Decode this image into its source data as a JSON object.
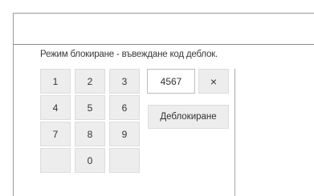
{
  "prompt": "Режим блокиране - въвеждане код деблок.",
  "keypad": {
    "keys": [
      {
        "name": "key-1",
        "label": "1"
      },
      {
        "name": "key-2",
        "label": "2"
      },
      {
        "name": "key-3",
        "label": "3"
      },
      {
        "name": "key-4",
        "label": "4"
      },
      {
        "name": "key-5",
        "label": "5"
      },
      {
        "name": "key-6",
        "label": "6"
      },
      {
        "name": "key-7",
        "label": "7"
      },
      {
        "name": "key-8",
        "label": "8"
      },
      {
        "name": "key-9",
        "label": "9"
      },
      {
        "name": "key-blank-left",
        "label": ""
      },
      {
        "name": "key-0",
        "label": "0"
      },
      {
        "name": "key-blank-right",
        "label": ""
      }
    ]
  },
  "code_entry": {
    "value": "4567",
    "clear_label": "×"
  },
  "unlock_button": {
    "label": "Деблокиране"
  }
}
